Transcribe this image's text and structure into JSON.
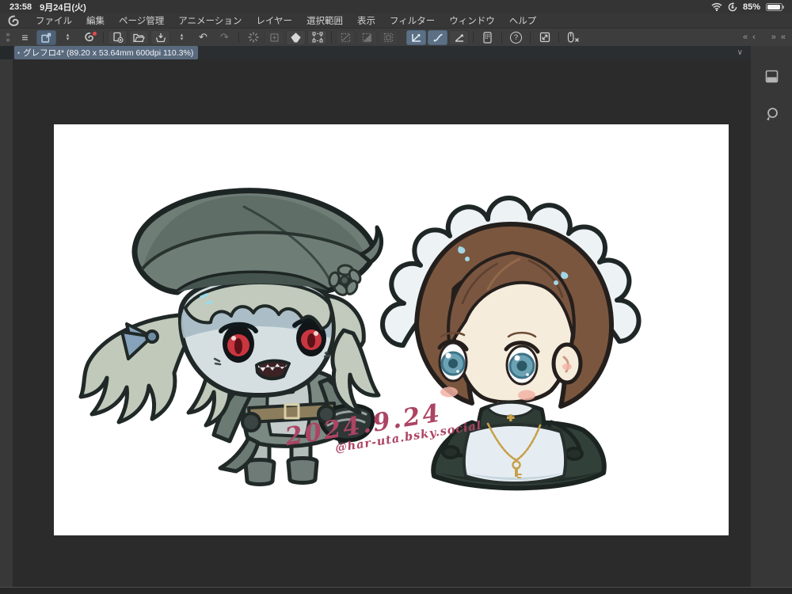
{
  "status_bar": {
    "time": "23:58",
    "date": "9月24日(火)",
    "battery_percent": "85%"
  },
  "menus": {
    "items": [
      "ファイル",
      "編集",
      "ページ管理",
      "アニメーション",
      "レイヤー",
      "選択範囲",
      "表示",
      "フィルター",
      "ウィンドウ",
      "ヘルプ"
    ]
  },
  "glyphs": {
    "hamburger": "≡",
    "chevron_up": "▴",
    "chevron_down": "▾",
    "undo": "↶",
    "redo": "↷",
    "expand_right": "»",
    "collapse_left": "«",
    "collapse_left_single": "‹",
    "collapse_right": "»",
    "collapse_right2": "«",
    "question": "?",
    "tab_bullet": "•",
    "tab_chevron": "∨"
  },
  "tab_bar": {
    "document_title": "グレフロ4* (89.20 x 53.64mm 600dpi 110.3%)"
  },
  "artwork": {
    "signature_date": "2024.9.24",
    "signature_handle": "@har-uta.bsky.social"
  },
  "colors": {
    "selection_accent": "#4e6175",
    "signature": "#ac4463",
    "canvas": "#ffffff",
    "workspace": "#2b2b2b"
  }
}
